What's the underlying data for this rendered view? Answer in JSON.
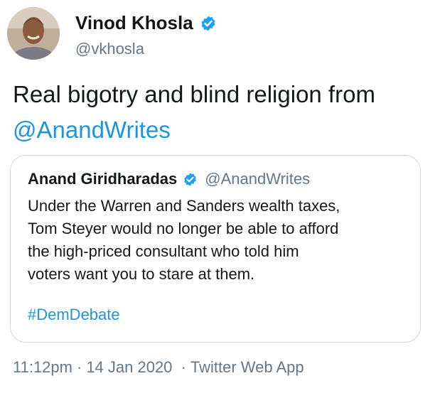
{
  "author": {
    "name": "Vinod Khosla",
    "handle": "@vkhosla"
  },
  "tweet": {
    "text": "Real bigotry and blind religion from",
    "mention": "@AnandWrites"
  },
  "quoted_tweet": {
    "name": "Anand Giridharadas",
    "handle": "@AnandWrites",
    "lines": [
      "Under the Warren and Sanders wealth taxes,",
      "Tom Steyer would no longer be able to afford",
      "the high-priced consultant who told him",
      "voters want you to stare at them."
    ],
    "hashtag": "#DemDebate"
  },
  "footer": {
    "time": "11:12pm",
    "separator": "·",
    "date": "14 Jan 2020",
    "source": "Twitter Web App"
  },
  "colors": {
    "link": "#1b95e0",
    "secondary_text": "#657786",
    "verified_badge": "#1da1f2",
    "card_border": "#ccd6dd"
  },
  "icons": {
    "verified": "verified-badge-icon"
  }
}
